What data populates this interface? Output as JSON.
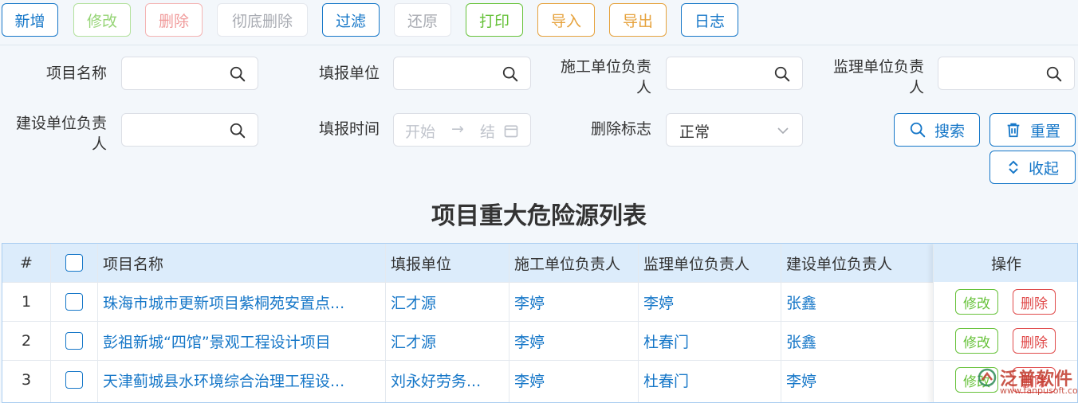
{
  "toolbar": {
    "buttons": [
      {
        "label": "新增",
        "color": "#1677c8"
      },
      {
        "label": "修改",
        "color": "#95d475"
      },
      {
        "label": "删除",
        "color": "#f4a3a3"
      },
      {
        "label": "彻底删除",
        "color": "#a8abb2"
      },
      {
        "label": "过滤",
        "color": "#1677c8"
      },
      {
        "label": "还原",
        "color": "#a8abb2"
      },
      {
        "label": "打印",
        "color": "#67c23a"
      },
      {
        "label": "导入",
        "color": "#e6a23c"
      },
      {
        "label": "导出",
        "color": "#e6a23c"
      },
      {
        "label": "日志",
        "color": "#1677c8"
      }
    ]
  },
  "filters": {
    "project_name_label": "项目名称",
    "report_unit_label": "填报单位",
    "construction_lead_label": "施工单位负责人",
    "supervision_lead_label": "监理单位负责人",
    "builder_lead_label": "建设单位负责人",
    "report_time_label": "填报时间",
    "date_start_placeholder": "开始",
    "date_arrow": "→",
    "date_end_placeholder": "结",
    "delete_flag_label": "删除标志",
    "delete_flag_value": "正常",
    "search_button": "搜索",
    "reset_button": "重置",
    "collapse_button": "收起"
  },
  "title": "项目重大危险源列表",
  "table": {
    "columns": [
      "#",
      "",
      "项目名称",
      "填报单位",
      "施工单位负责人",
      "监理单位负责人",
      "建设单位负责人",
      "操作"
    ],
    "rows": [
      {
        "index": "1",
        "project": "珠海市城市更新项目紫桐苑安置点...",
        "unit": "汇才源",
        "construction": "李婷",
        "supervision": "李婷",
        "builder": "张鑫"
      },
      {
        "index": "2",
        "project": "彭祖新城“四馆”景观工程设计项目",
        "unit": "汇才源",
        "construction": "李婷",
        "supervision": "杜春门",
        "builder": "张鑫"
      },
      {
        "index": "3",
        "project": "天津蓟城县水环境综合治理工程设...",
        "unit": "刘永好劳务...",
        "construction": "李婷",
        "supervision": "杜春门",
        "builder": "李婷"
      }
    ],
    "edit_label": "修改",
    "delete_label": "删除"
  },
  "watermark": {
    "text": "泛普软件",
    "sub": "www.fanpusoft.com"
  },
  "colors": {
    "primary": "#1677c8",
    "success": "#67c23a",
    "danger": "#e04b4b",
    "warning": "#e6a23c"
  }
}
